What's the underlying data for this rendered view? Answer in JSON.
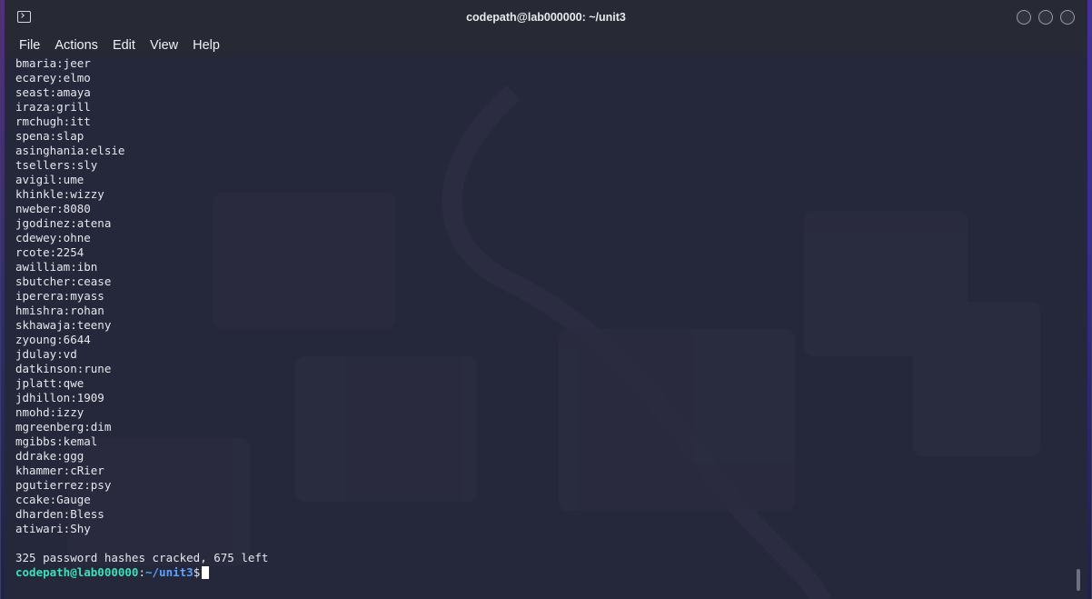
{
  "window": {
    "title": "codepath@lab000000: ~/unit3",
    "icon": "terminal-icon",
    "controls": [
      "minimize-icon",
      "maximize-icon",
      "close-icon"
    ]
  },
  "menu": {
    "file": "File",
    "actions": "Actions",
    "edit": "Edit",
    "view": "View",
    "help": "Help"
  },
  "output": {
    "lines": [
      "bmaria:jeer",
      "ecarey:elmo",
      "seast:amaya",
      "iraza:grill",
      "rmchugh:itt",
      "spena:slap",
      "asinghania:elsie",
      "tsellers:sly",
      "avigil:ume",
      "khinkle:wizzy",
      "nweber:8080",
      "jgodinez:atena",
      "cdewey:ohne",
      "rcote:2254",
      "awilliam:ibn",
      "sbutcher:cease",
      "iperera:myass",
      "hmishra:rohan",
      "skhawaja:teeny",
      "zyoung:6644",
      "jdulay:vd",
      "datkinson:rune",
      "jplatt:qwe",
      "jdhillon:1909",
      "nmohd:izzy",
      "mgreenberg:dim",
      "mgibbs:kemal",
      "ddrake:ggg",
      "khammer:cRier",
      "pgutierrez:psy",
      "ccake:Gauge",
      "dharden:Bless",
      "atiwari:Shy",
      "",
      "325 password hashes cracked, 675 left"
    ]
  },
  "prompt": {
    "user_host": "codepath@lab000000",
    "separator": ":",
    "path": "~/unit3",
    "symbol": "$"
  },
  "colors": {
    "prompt_user": "#3ee0b8",
    "prompt_path": "#5aa2ff",
    "terminal_bg": "#25273a",
    "text": "#e6e7ec"
  }
}
